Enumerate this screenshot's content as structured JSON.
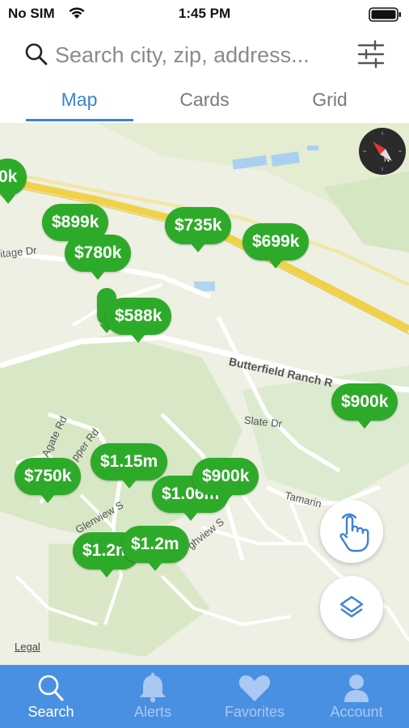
{
  "status_bar": {
    "carrier": "No SIM",
    "time": "1:45 PM"
  },
  "search": {
    "placeholder": "Search city, zip, address..."
  },
  "tabs": [
    {
      "label": "Map",
      "active": true
    },
    {
      "label": "Cards",
      "active": false
    },
    {
      "label": "Grid",
      "active": false
    }
  ],
  "map": {
    "streets": {
      "butterfield": "Butterfield Ranch R",
      "slate": "Slate Dr",
      "agate": "Agate Rd",
      "copper": "pper Rd",
      "glenview": "Glenview S",
      "highview": "ghview S",
      "tamarind": "Tamarin",
      "heritage": "itage Dr"
    },
    "legal": "Legal",
    "pins": [
      {
        "price": "0k"
      },
      {
        "price": "$899k"
      },
      {
        "price": "$780k"
      },
      {
        "price": "$735k"
      },
      {
        "price": "$699k"
      },
      {
        "price": "$588k"
      },
      {
        "price": "$900k"
      },
      {
        "price": "$750k"
      },
      {
        "price": "$1.15m"
      },
      {
        "price": "$1.06m"
      },
      {
        "price": "$900k"
      },
      {
        "price": "$1.2m"
      },
      {
        "price": "$1.2m"
      }
    ]
  },
  "bottom_tabs": [
    {
      "label": "Search",
      "icon": "search-icon",
      "active": true
    },
    {
      "label": "Alerts",
      "icon": "bell-icon",
      "active": false
    },
    {
      "label": "Favorites",
      "icon": "heart-icon",
      "active": false
    },
    {
      "label": "Account",
      "icon": "person-icon",
      "active": false
    }
  ],
  "colors": {
    "accent": "#3d82d6",
    "pin": "#2eaa2a",
    "tab_bar": "#4a90e2"
  }
}
